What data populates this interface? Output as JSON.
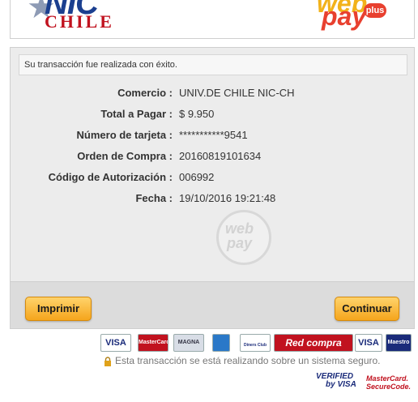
{
  "header": {
    "merchant_logo_top": "NIC",
    "merchant_logo_bottom": "CHILE",
    "gateway_logo_top": "web",
    "gateway_logo_bottom": "pay",
    "gateway_logo_badge": "plus"
  },
  "message": "Su transacción fue realizada con éxito.",
  "details": [
    {
      "label": "Comercio :",
      "value": "UNIV.DE CHILE NIC-CH"
    },
    {
      "label": "Total a Pagar :",
      "value": "$ 9.950"
    },
    {
      "label": "Número de tarjeta :",
      "value": "***********9541"
    },
    {
      "label": "Orden de Compra :",
      "value": "20160819101634"
    },
    {
      "label": "Código de Autorización :",
      "value": "006992"
    },
    {
      "label": "Fecha :",
      "value": "19/10/2016 19:21:48"
    }
  ],
  "watermark": {
    "top": "web",
    "bottom": "pay"
  },
  "buttons": {
    "print": "Imprimir",
    "continue": "Continuar"
  },
  "cards": [
    "VISA",
    "MasterCard",
    "MAGNA",
    "AMEX",
    "Diners Club",
    "Red compra",
    "VISA",
    "Maestro"
  ],
  "secure_text": "Esta transacción se está realizando sobre un sistema seguro.",
  "badges": {
    "verified_line1": "VERIFIED",
    "verified_line2": "by VISA",
    "mc_line1": "MasterCard.",
    "mc_line2": "SecureCode."
  },
  "colors": {
    "accent": "#f5a51c",
    "brand_red": "#e8402f",
    "brand_blue": "#1b3f8f"
  }
}
